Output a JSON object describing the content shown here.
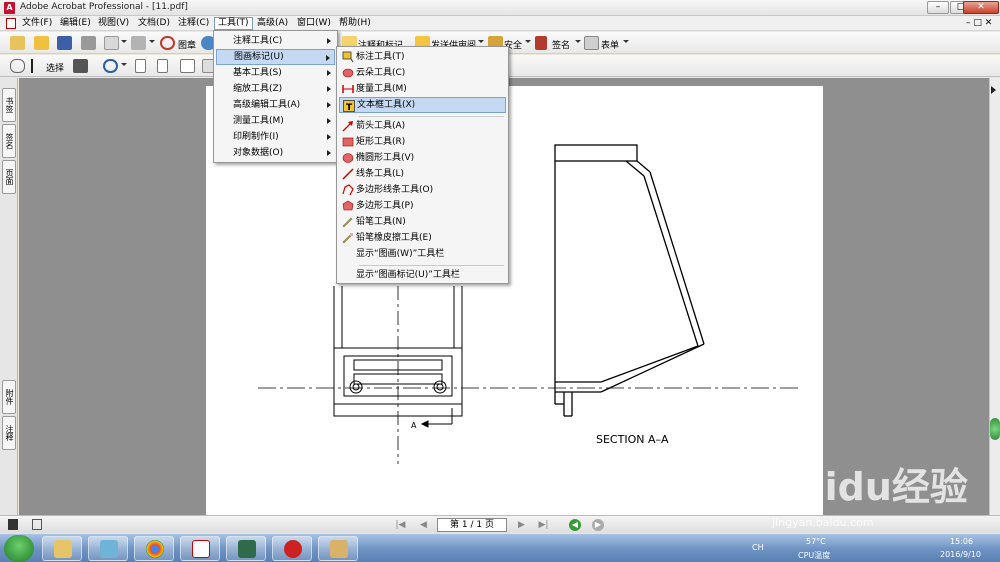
{
  "window": {
    "title": "Adobe Acrobat Professional - [11.pdf]"
  },
  "menubar": [
    "文件(F)",
    "编辑(E)",
    "视图(V)",
    "文档(D)",
    "注释(C)",
    "工具(T)",
    "高级(A)",
    "窗口(W)",
    "帮助(H)"
  ],
  "toolbar1": {
    "stamp_label": "图章",
    "comment_label": "注释和标记",
    "review_label": "发送供审阅",
    "security_label": "安全",
    "sign_label": "签名",
    "forms_label": "表单"
  },
  "toolbar2": {
    "select_label": "选择"
  },
  "side_tabs": [
    "书签",
    "签名",
    "页面",
    "附件",
    "注释"
  ],
  "tools_menu": [
    {
      "label": "注释工具(C)",
      "sub": true
    },
    {
      "label": "图画标记(U)",
      "sub": true,
      "highlighted": true
    },
    {
      "label": "基本工具(S)",
      "sub": true
    },
    {
      "label": "缩放工具(Z)",
      "sub": true
    },
    {
      "label": "高级编辑工具(A)",
      "sub": true
    },
    {
      "label": "测量工具(M)",
      "sub": true
    },
    {
      "label": "印刷制作(I)",
      "sub": true
    },
    {
      "label": "对象数据(O)",
      "sub": true
    }
  ],
  "markup_menu": {
    "items": [
      {
        "label": "标注工具(T)",
        "icon": "callout-icon",
        "color": "#f1c232"
      },
      {
        "label": "云朵工具(C)",
        "icon": "cloud-icon",
        "color": "#e06666"
      },
      {
        "label": "度量工具(M)",
        "icon": "dimension-icon",
        "color": "#cc0000"
      },
      {
        "label": "文本框工具(X)",
        "icon": "textbox-icon",
        "color": "#f1c232",
        "highlighted": true
      },
      {
        "label": "箭头工具(A)",
        "icon": "arrow-icon",
        "color": "#cc0000"
      },
      {
        "label": "矩形工具(R)",
        "icon": "rectangle-icon",
        "color": "#e06666"
      },
      {
        "label": "椭圆形工具(V)",
        "icon": "oval-icon",
        "color": "#e06666"
      },
      {
        "label": "线条工具(L)",
        "icon": "line-icon",
        "color": "#cc0000"
      },
      {
        "label": "多边形线条工具(O)",
        "icon": "polyline-icon",
        "color": "#e06666"
      },
      {
        "label": "多边形工具(P)",
        "icon": "polygon-icon",
        "color": "#e06666"
      },
      {
        "label": "铅笔工具(N)",
        "icon": "pencil-icon",
        "color": "#e69138"
      },
      {
        "label": "铅笔橡皮擦工具(E)",
        "icon": "eraser-icon",
        "color": "#e69138"
      }
    ],
    "show_drawing_toolbar": "显示“图画(W)”工具栏",
    "show_markup_toolbar": "显示“图画标记(U)”工具栏"
  },
  "drawing": {
    "section_label": "SECTION  A–A",
    "cut_label": "A"
  },
  "statusbar": {
    "page_indicator": "第 1 / 1 页"
  },
  "taskbar": {
    "lang": "CH",
    "temp": "57°C",
    "cpu_label": "CPU温度",
    "time": "15:06",
    "date": "2016/9/10"
  },
  "watermark": {
    "brand": "Baidu经验",
    "url": "jingyan.baidu.com"
  }
}
